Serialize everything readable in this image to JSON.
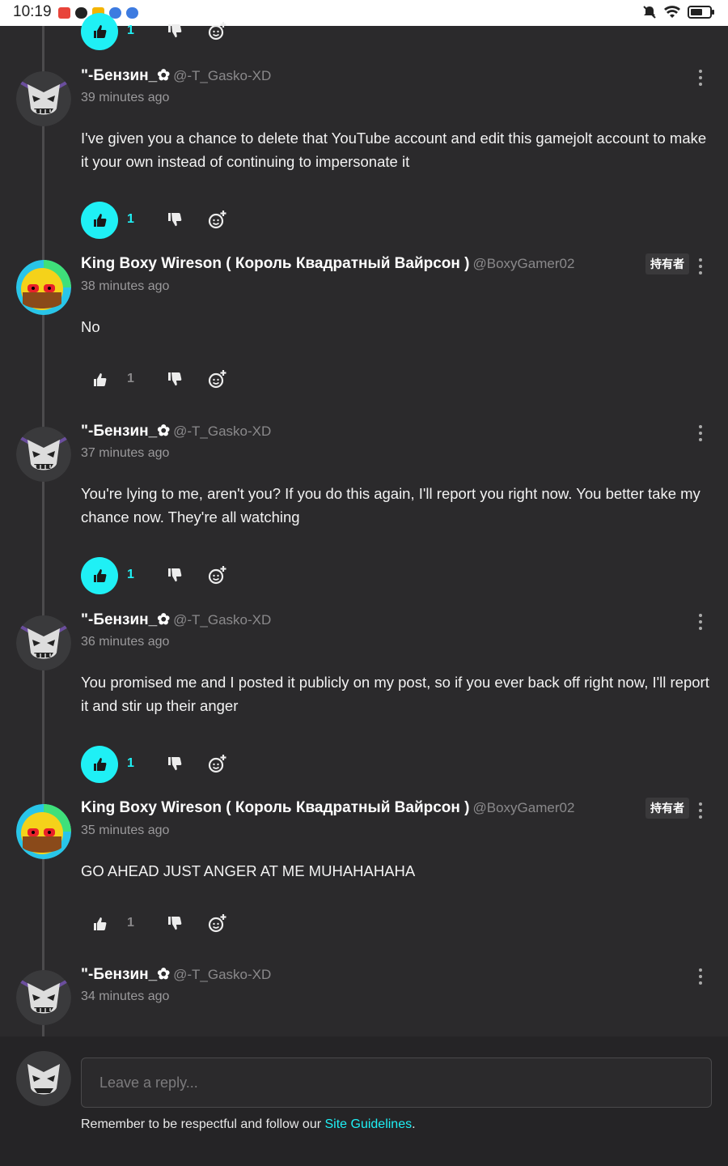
{
  "status_bar": {
    "time": "10:19"
  },
  "colors": {
    "accent": "#1ff0f5",
    "background": "#2b2a2c"
  },
  "top_partial": {
    "like_count": "1"
  },
  "comments": [
    {
      "name": "\"-Бензин_✿",
      "handle": "@-T_Gasko-XD",
      "time": "39 minutes ago",
      "body": "I've given you a chance to delete that YouTube account and edit this gamejolt account to make it your own instead of continuing to impersonate it",
      "like_count": "1",
      "liked": true,
      "avatar": "dark-mask-avatar"
    },
    {
      "name": "King Boxy Wireson ( Король Квадратный Вайрсон )",
      "handle": "@BoxyGamer02",
      "time": "38 minutes ago",
      "body": "No",
      "like_count": "1",
      "liked": false,
      "badge": "持有者",
      "avatar": "boxy-avatar"
    },
    {
      "name": "\"-Бензин_✿",
      "handle": "@-T_Gasko-XD",
      "time": "37 minutes ago",
      "body": "You're lying to me, aren't you? If you do this again, I'll report you right now. You better take my chance now. They're all watching",
      "like_count": "1",
      "liked": true,
      "avatar": "dark-mask-avatar"
    },
    {
      "name": "\"-Бензин_✿",
      "handle": "@-T_Gasko-XD",
      "time": "36 minutes ago",
      "body": "You promised me and I posted it publicly on my post, so if you ever back off right now, I'll report it and stir up their anger",
      "like_count": "1",
      "liked": true,
      "avatar": "dark-mask-avatar"
    },
    {
      "name": "King Boxy Wireson ( Король Квадратный Вайрсон )",
      "handle": "@BoxyGamer02",
      "time": "35 minutes ago",
      "body": "GO AHEAD JUST ANGER AT ME MUHAHAHAHA",
      "like_count": "1",
      "liked": false,
      "badge": "持有者",
      "avatar": "boxy-avatar"
    },
    {
      "name": "\"-Бензин_✿",
      "handle": "@-T_Gasko-XD",
      "time": "34 minutes ago",
      "body": "",
      "avatar": "dark-mask-avatar"
    }
  ],
  "reply": {
    "placeholder": "Leave a reply...",
    "guidelines_prefix": "Remember to be respectful and follow our ",
    "guidelines_link": "Site Guidelines",
    "guidelines_suffix": "."
  }
}
